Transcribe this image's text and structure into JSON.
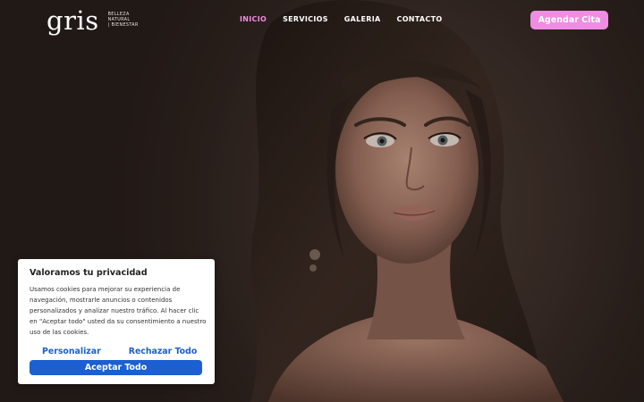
{
  "header": {
    "logo": {
      "word": "gris",
      "tagline": [
        "BELLEZA",
        "NATURAL",
        "| BIENESTAR"
      ]
    },
    "nav": [
      {
        "label": "INICIO",
        "active": true
      },
      {
        "label": "SERVICIOS",
        "active": false
      },
      {
        "label": "GALERIA",
        "active": false
      },
      {
        "label": "CONTACTO",
        "active": false
      }
    ],
    "cta_label": "Agendar Cita"
  },
  "hero": {
    "image": "portrait-woman-updo"
  },
  "cookie_banner": {
    "title": "Valoramos tu privacidad",
    "text": "Usamos cookies para mejorar su experiencia de navegación, mostrarle anuncios o contenidos personalizados y analizar nuestro tráfico. Al hacer clic en \"Aceptar todo\" usted da su consentimiento a nuestro uso de las cookies.",
    "customize_label": "Personalizar",
    "reject_label": "Rechazar Todo",
    "accept_label": "Aceptar Todo"
  },
  "colors": {
    "accent_pink": "#f08ce3",
    "accept_blue": "#1b5fd0",
    "link_blue": "#1b5fc7"
  }
}
